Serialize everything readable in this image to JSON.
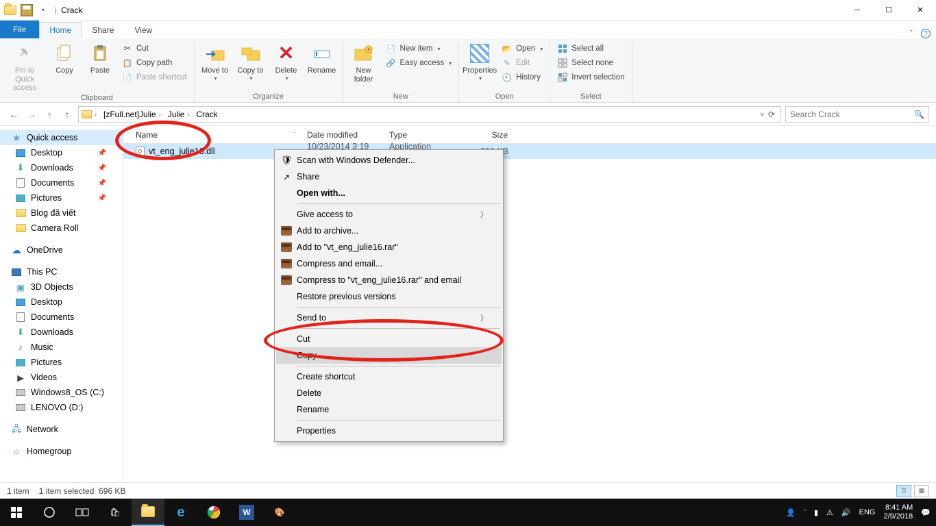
{
  "title": {
    "app": "Crack",
    "sep": "|"
  },
  "tabs": {
    "file": "File",
    "home": "Home",
    "share": "Share",
    "view": "View"
  },
  "ribbon": {
    "clipboard": {
      "label": "Clipboard",
      "pin": "Pin to Quick access",
      "copy": "Copy",
      "paste": "Paste",
      "cut": "Cut",
      "copypath": "Copy path",
      "pasteshortcut": "Paste shortcut"
    },
    "organize": {
      "label": "Organize",
      "moveto": "Move to",
      "copyto": "Copy to",
      "delete": "Delete",
      "rename": "Rename"
    },
    "new_sec": {
      "label": "New",
      "newfolder": "New folder",
      "newitem": "New item",
      "easyaccess": "Easy access"
    },
    "open_sec": {
      "label": "Open",
      "properties": "Properties",
      "open": "Open",
      "edit": "Edit",
      "history": "History"
    },
    "select_sec": {
      "label": "Select",
      "selectall": "Select all",
      "selectnone": "Select none",
      "invert": "Invert selection"
    }
  },
  "breadcrumb": [
    "[zFull.net]Julie",
    "Julie",
    "Crack"
  ],
  "search": {
    "placeholder": "Search Crack"
  },
  "columns": {
    "name": "Name",
    "date": "Date modified",
    "type": "Type",
    "size": "Size"
  },
  "file_row": {
    "name": "vt_eng_julie16.dll",
    "date": "10/23/2014 3:19 AM",
    "type": "Application extens...",
    "size": "696 KB"
  },
  "sidebar": {
    "quick": {
      "label": "Quick access",
      "items": [
        "Desktop",
        "Downloads",
        "Documents",
        "Pictures",
        "Blog đã viết",
        "Camera Roll"
      ]
    },
    "onedrive": "OneDrive",
    "thispc": {
      "label": "This PC",
      "items": [
        "3D Objects",
        "Desktop",
        "Documents",
        "Downloads",
        "Music",
        "Pictures",
        "Videos",
        "Windows8_OS (C:)",
        "LENOVO (D:)"
      ]
    },
    "network": "Network",
    "homegroup": "Homegroup"
  },
  "context": {
    "scan": "Scan with Windows Defender...",
    "share": "Share",
    "openwith": "Open with...",
    "giveaccess": "Give access to",
    "addarchive": "Add to archive...",
    "addrar": "Add to \"vt_eng_julie16.rar\"",
    "compressmail": "Compress and email...",
    "compressrar": "Compress to \"vt_eng_julie16.rar\" and email",
    "restore": "Restore previous versions",
    "sendto": "Send to",
    "cut": "Cut",
    "copy": "Copy",
    "shortcut": "Create shortcut",
    "delete": "Delete",
    "rename": "Rename",
    "properties": "Properties"
  },
  "status": {
    "items": "1 item",
    "selected": "1 item selected",
    "size": "696 KB"
  },
  "tray": {
    "lang": "ENG",
    "time": "8:41 AM",
    "date": "2/9/2018"
  }
}
